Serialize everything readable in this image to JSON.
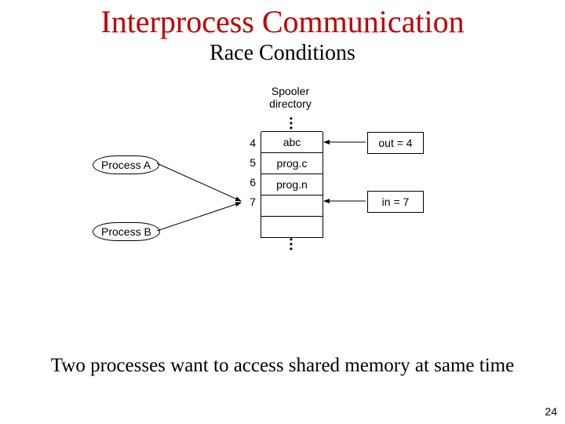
{
  "title": "Interprocess Communication",
  "subtitle": "Race Conditions",
  "caption": "Two processes want to access shared memory at same time",
  "page_number": "24",
  "diagram": {
    "spooler_label": "Spooler\ndirectory",
    "process_a": "Process A",
    "process_b": "Process B",
    "out_var": "out = 4",
    "in_var": "in = 7",
    "slots": [
      {
        "index": "4",
        "content": "abc"
      },
      {
        "index": "5",
        "content": "prog.c"
      },
      {
        "index": "6",
        "content": "prog.n"
      },
      {
        "index": "7",
        "content": ""
      },
      {
        "index": "",
        "content": ""
      }
    ]
  }
}
